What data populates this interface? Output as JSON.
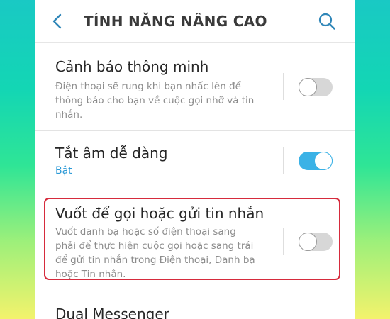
{
  "header": {
    "title": "TÍNH NĂNG NÂNG CAO",
    "back_icon": "chevron-left-icon",
    "search_icon": "search-icon"
  },
  "settings": [
    {
      "title": "Cảnh báo thông minh",
      "desc_lines": [
        "Điện thoại sẽ rung khi bạn nhấc lên để",
        "thông báo cho bạn về cuộc gọi nhỡ và tin",
        "nhắn."
      ],
      "enabled": false
    },
    {
      "title": "Tắt âm dễ dàng",
      "status": "Bật",
      "enabled": true
    },
    {
      "title": "Vuốt để gọi hoặc gửi tin nhắn",
      "desc_lines": [
        "Vuốt danh bạ hoặc số điện thoại sang",
        "phải để thực hiện cuộc gọi hoặc sang trái",
        "để gửi tin nhắn trong Điện thoại, Danh bạ",
        "hoặc Tin nhắn."
      ],
      "enabled": false,
      "highlighted": true
    },
    {
      "title": "Dual Messenger"
    }
  ],
  "colors": {
    "accent": "#3bb2e6",
    "status_text": "#2d9ad6",
    "highlight_border": "#d62b3d"
  }
}
